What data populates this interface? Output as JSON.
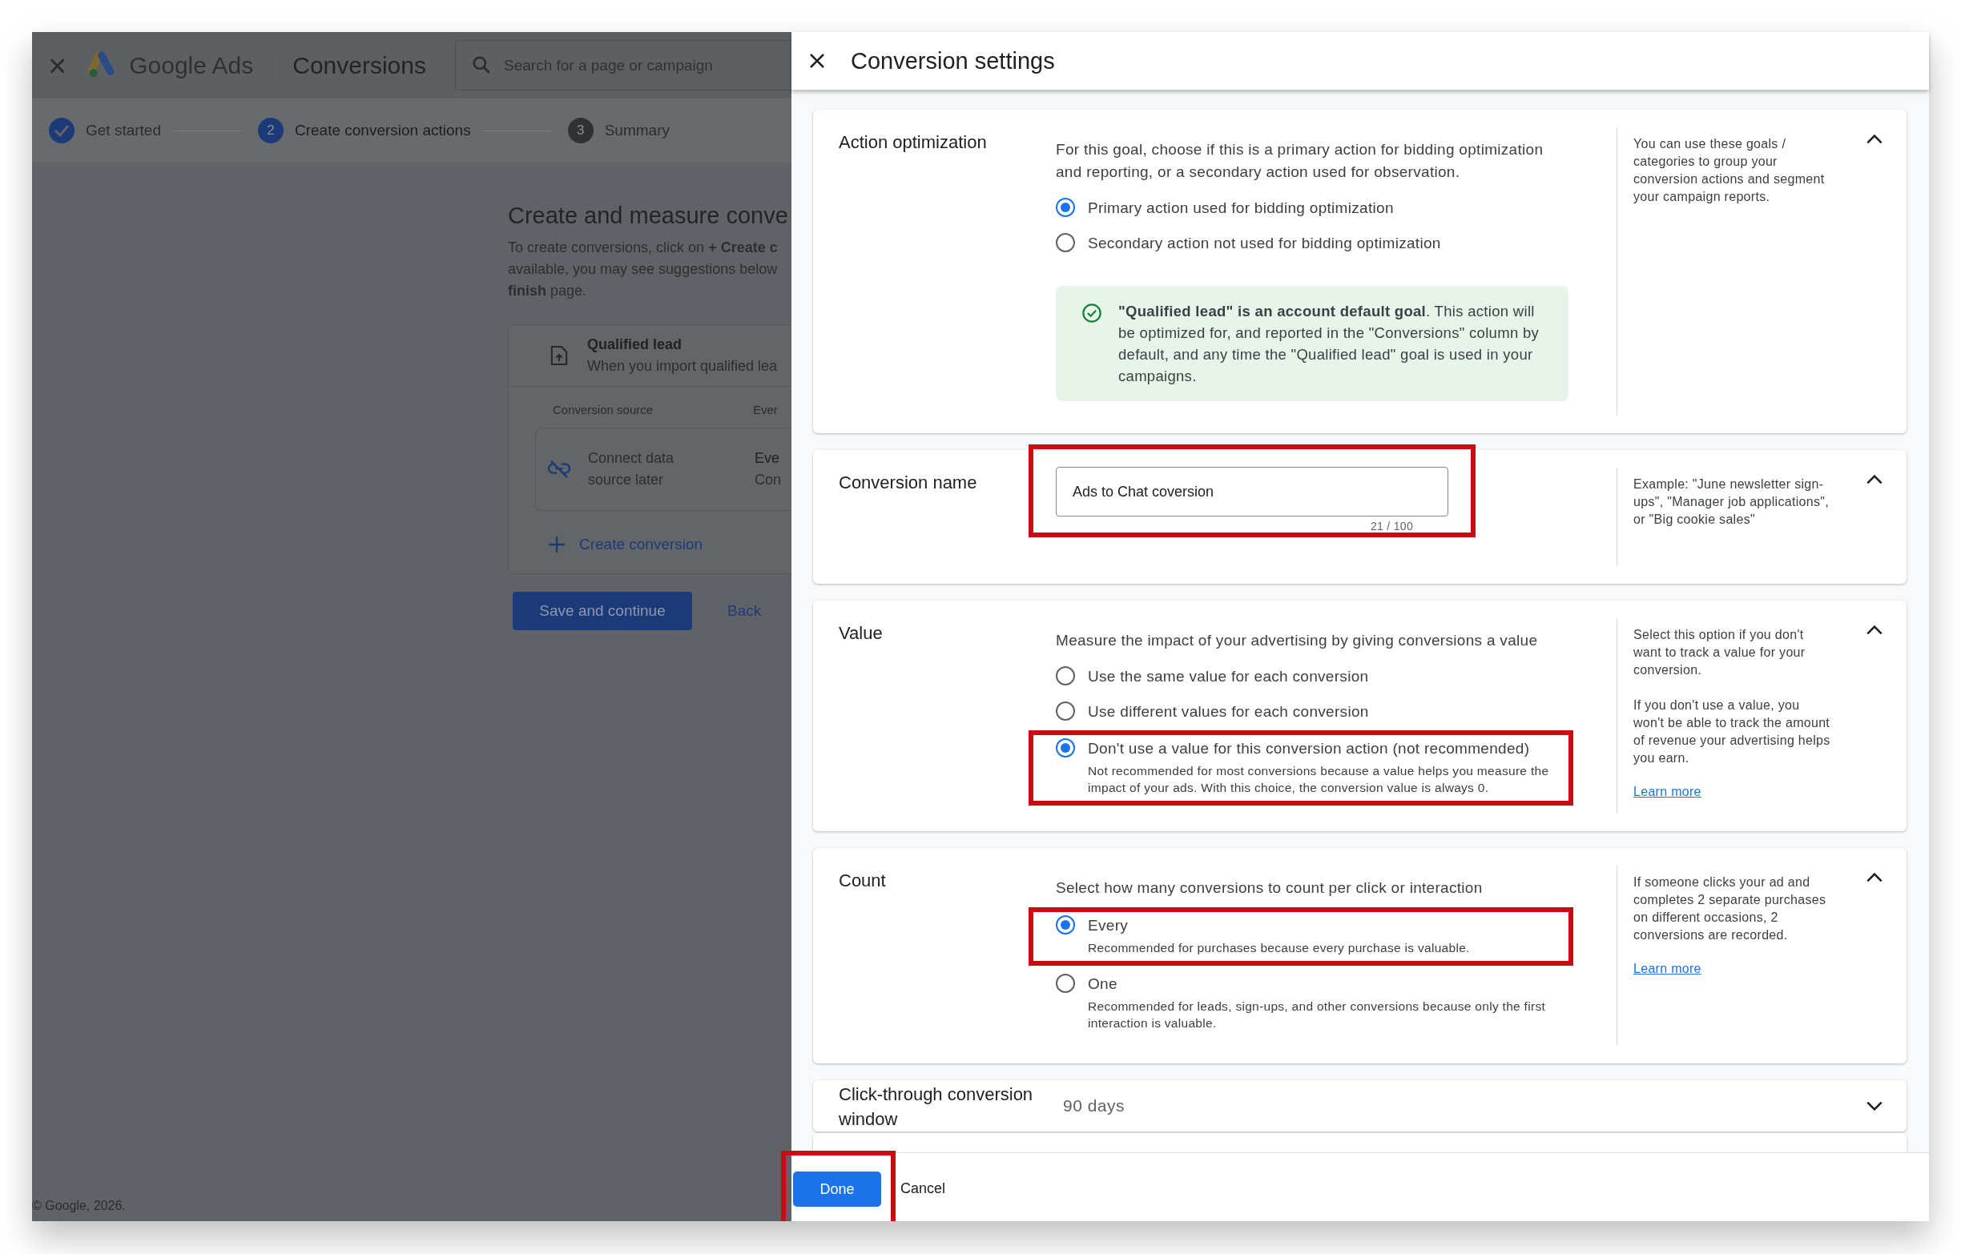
{
  "app_header": {
    "close": "×",
    "brand": "Google Ads",
    "page": "Conversions",
    "search": {
      "placeholder": "Search for a page or campaign"
    }
  },
  "stepper": [
    {
      "completed": true,
      "selected": false,
      "label": "Get started"
    },
    {
      "completed": false,
      "selected": true,
      "number": "2",
      "label": "Create conversion actions"
    },
    {
      "completed": false,
      "selected": false,
      "number": "3",
      "label": "Summary"
    }
  ],
  "main": {
    "heading": "Create and measure conve",
    "intro_lines": [
      "To create conversions, click on **+ Create c**",
      "available, you may see suggestions below",
      "**finish** page."
    ],
    "goal_card": {
      "title": "Qualified lead",
      "subtitle": "When you import qualified lea",
      "source_header": "Conversion source",
      "column_2_header": "Ever",
      "source": "Connect data source later",
      "column_2_lines": [
        "Eve",
        "Con"
      ],
      "create_link": "Create conversion"
    },
    "save_button": "Save and continue",
    "back_link": "Back"
  },
  "footer": "© Google, 2026.",
  "panel": {
    "title": "Conversion settings",
    "sections": [
      {
        "kind": "radio",
        "title": "Action optimization",
        "expanded": true,
        "description": "For this goal, choose if this is a primary action for bidding optimization and reporting, or a secondary action used for observation.",
        "options": [
          {
            "label": "Primary action used for bidding optimization",
            "selected": true,
            "highlighted": false
          },
          {
            "label": "Secondary action not used for bidding optimization",
            "selected": false,
            "highlighted": false
          }
        ],
        "notice": "**\"Qualified lead\" is an account default goal**. This action will be optimized for, and reported in the \"Conversions\" column by default, and any time the \"Qualified lead\" goal is used in your campaigns.",
        "help": [
          "You can use these goals / categories to group your conversion actions and segment your campaign reports."
        ]
      },
      {
        "kind": "text",
        "title": "Conversion name",
        "expanded": true,
        "value": "Ads to Chat coversion",
        "counter": "21 / 100",
        "highlighted": true,
        "help": [
          "Example: \"June newsletter sign-ups\", \"Manager job applications\", or \"Big cookie sales\""
        ]
      },
      {
        "kind": "radio",
        "title": "Value",
        "expanded": true,
        "description": "Measure the impact of your advertising by giving conversions a value",
        "options": [
          {
            "label": "Use the same value for each conversion",
            "selected": false,
            "highlighted": false
          },
          {
            "label": "Use different values for each conversion",
            "selected": false,
            "highlighted": false
          },
          {
            "label": "Don't use a value for this conversion action (not recommended)",
            "detail": "Not recommended for most conversions because a value helps you measure the impact of your ads. With this choice, the conversion value is always 0.",
            "selected": true,
            "highlighted": true
          }
        ],
        "help": [
          "Select this option if you don't want to track a value for your conversion.",
          "If you don't use a value, you won't be able to track the amount of revenue your advertising helps you earn."
        ],
        "help_link": "Learn more"
      },
      {
        "kind": "radio",
        "title": "Count",
        "expanded": true,
        "description": "Select how many conversions to count per click or interaction",
        "options": [
          {
            "label": "Every",
            "detail": "Recommended for purchases because every purchase is valuable.",
            "selected": true,
            "highlighted": true
          },
          {
            "label": "One",
            "detail": "Recommended for leads, sign-ups, and other conversions because only the first interaction is valuable.",
            "selected": false,
            "highlighted": false
          }
        ],
        "help": [
          "If someone clicks your ad and completes 2 separate purchases on different occasions, 2 conversions are recorded."
        ],
        "help_link": "Learn more"
      },
      {
        "kind": "summary",
        "title": "Click-through conversion window",
        "expanded": false,
        "value": "90 days"
      }
    ],
    "done_button": {
      "label": "Done",
      "highlighted": true
    },
    "cancel_button": "Cancel"
  }
}
